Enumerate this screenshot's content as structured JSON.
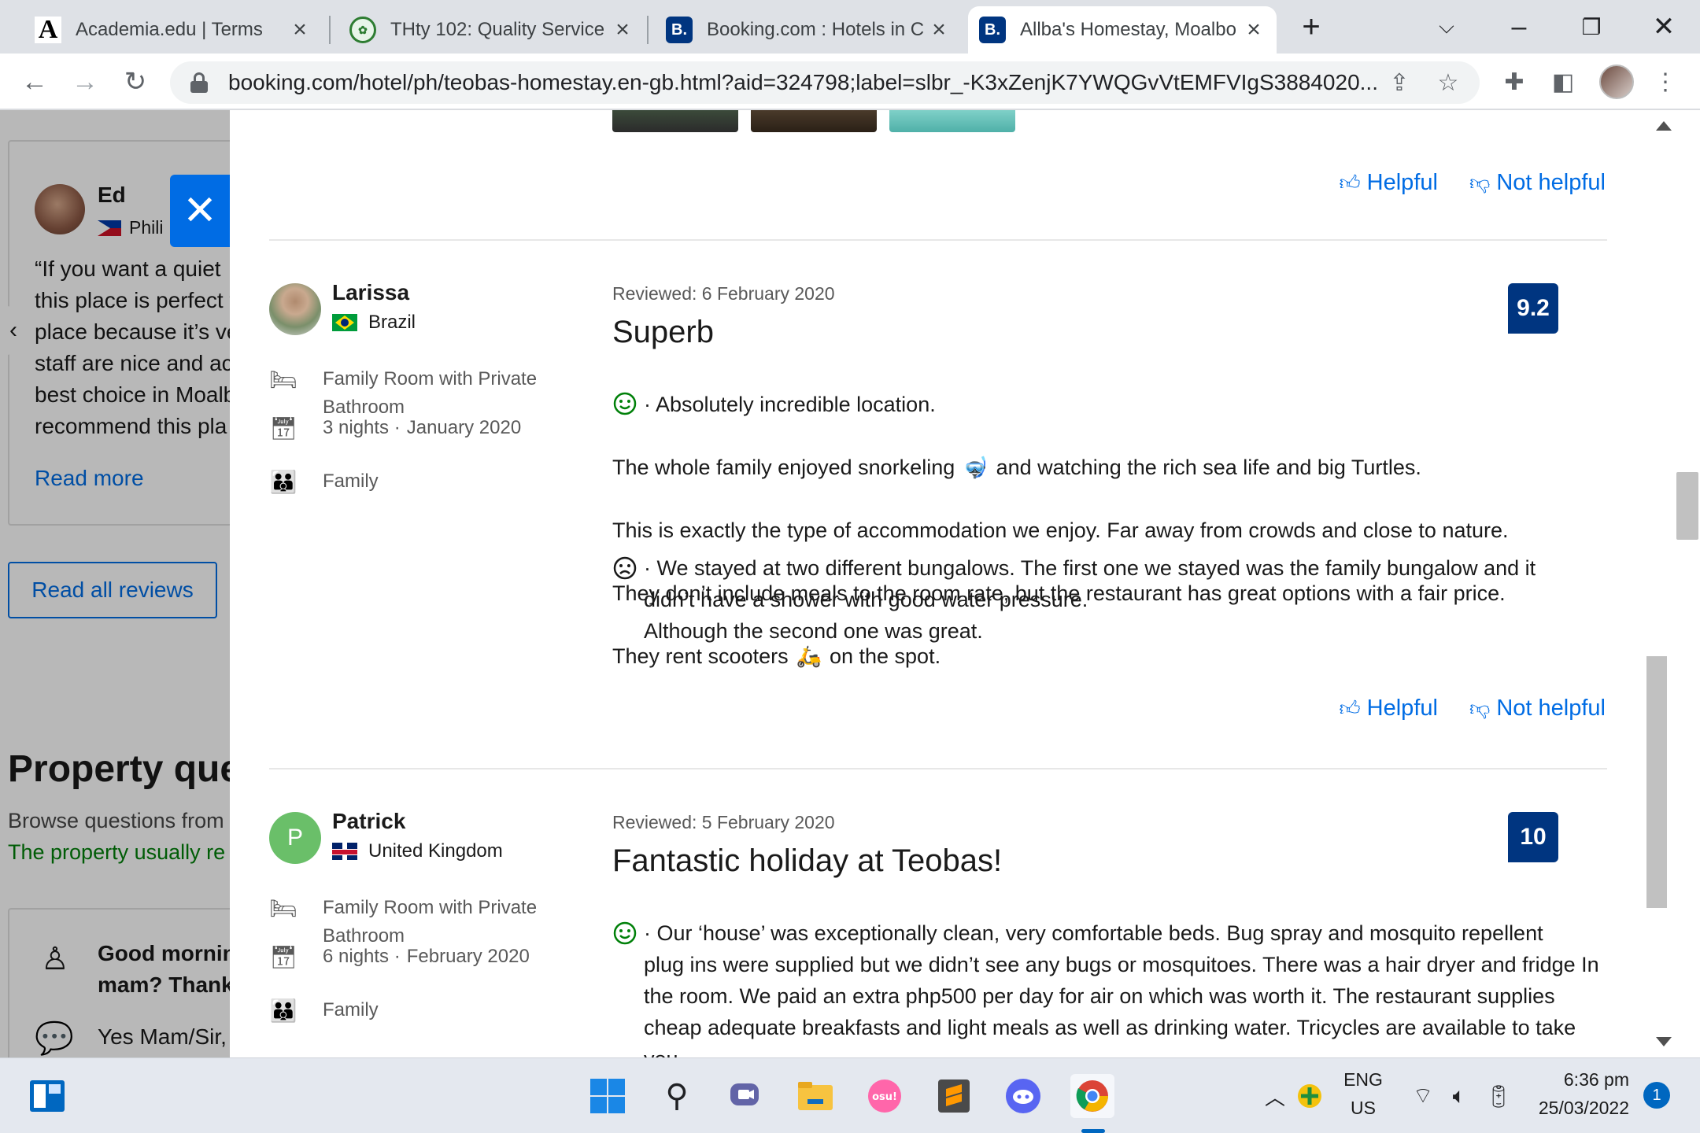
{
  "browser": {
    "tabs": [
      {
        "title": "Academia.edu | Terms",
        "favicon": "academia-icon",
        "active": false
      },
      {
        "title": "THty 102: Quality Service",
        "favicon": "university-seal-icon",
        "active": false
      },
      {
        "title": "Booking.com : Hotels in C",
        "favicon": "booking-icon",
        "active": false
      },
      {
        "title": "Allba's Homestay, Moalbo",
        "favicon": "booking-icon",
        "active": true
      }
    ],
    "url": "booking.com/hotel/ph/teobas-homestay.en-gb.html?aid=324798;label=slbr_-K3xZenjK7YWQGvVtEMFVIgS3884020..."
  },
  "background_page": {
    "reviewer_name": "Ed",
    "reviewer_country": "Phili",
    "quote": "“If you want a quiet\nthis place is perfect f\nplace because it’s ve\nstaff are nice and ac\nbest choice in Moalb\nrecommend this pla",
    "read_more": "Read more",
    "read_all_reviews": "Read all reviews",
    "property_title": "Property que",
    "property_sub": "Browse questions from",
    "property_green": "The property usually re",
    "question": "Good mornin\nmam? Thank",
    "answer": "Yes Mam/Sir,"
  },
  "panel": {
    "helpful": "Helpful",
    "not_helpful": "Not helpful",
    "reviews": [
      {
        "name": "Larissa",
        "country": "Brazil",
        "room": "Family Room with Private\nBathroom",
        "nights": "3 nights ·",
        "stay_date": "January 2020",
        "group": "Family",
        "date": "Reviewed: 6 February 2020",
        "title": "Superb",
        "score": "9.2",
        "positive_line1": "· Absolutely incredible location.",
        "positive_line2a": "The whole family enjoyed snorkeling",
        "positive_line2b": "and watching the rich sea life and big Turtles.",
        "positive_line3": "This is exactly the type of accommodation we enjoy. Far away from crowds and close to nature.",
        "positive_line4": "They don’t include meals to the room rate, but the restaurant has great options with a fair price.",
        "positive_line5a": "They rent scooters",
        "positive_line5b": "on the spot.",
        "negative": "· We stayed at two different bungalows. The first one we stayed was the family bungalow and it\ndidn’t have a shower with good water pressure.\nAlthough the second one was great."
      },
      {
        "name": "Patrick",
        "initial": "P",
        "country": "United Kingdom",
        "room": "Family Room with Private\nBathroom",
        "nights": "6 nights ·",
        "stay_date": "February 2020",
        "group": "Family",
        "date": "Reviewed: 5 February 2020",
        "title": "Fantastic holiday at Teobas!",
        "score": "10",
        "positive": "· Our ‘house’ was exceptionally clean, very comfortable beds. Bug spray and mosquito repellent\nplug ins were supplied but we didn’t see any bugs or mosquitoes. There was a hair dryer and fridge In\nthe room. We paid an extra php500 per day for air on which was worth it. The restaurant supplies\ncheap adequate breakfasts and light meals as well as drinking water. Tricycles are available to take you"
      }
    ]
  },
  "taskbar": {
    "lang1": "ENG",
    "lang2": "US",
    "time": "6:36 pm",
    "date": "25/03/2022",
    "notifications": "1"
  },
  "colors": {
    "brand_blue": "#003580",
    "link_blue": "#006ce4",
    "positive_green": "#008009"
  }
}
